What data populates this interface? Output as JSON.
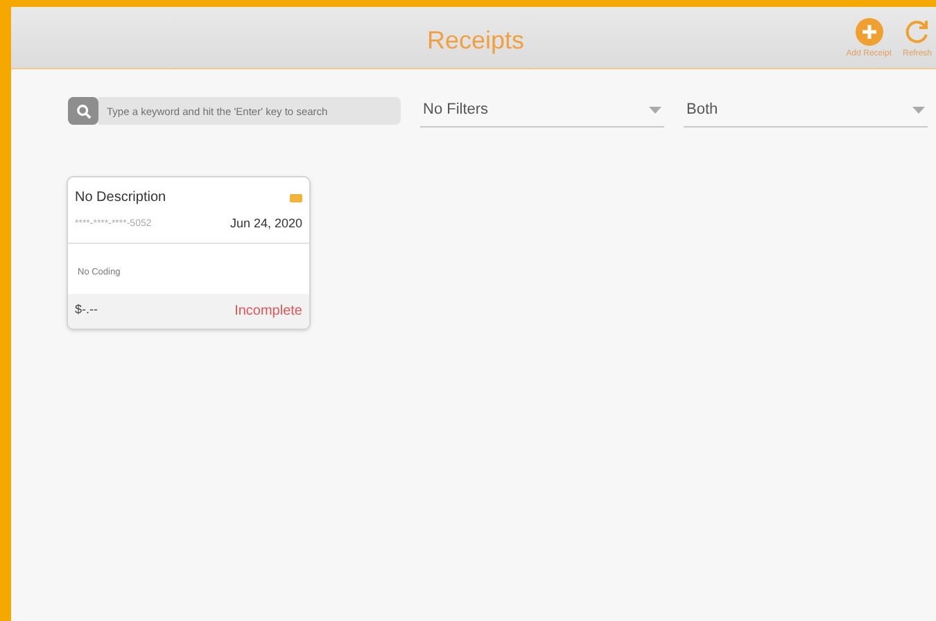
{
  "header": {
    "title": "Receipts",
    "actions": [
      {
        "kind": "add",
        "label": "Add Receipt"
      },
      {
        "kind": "refresh",
        "label": "Refresh"
      }
    ]
  },
  "search": {
    "placeholder": "Type a keyword and hit the 'Enter' key to search"
  },
  "filters": [
    {
      "value": "No Filters"
    },
    {
      "value": "Both"
    }
  ],
  "receipts": [
    {
      "description": "No Description",
      "card": "****-****-****-5052",
      "date": "Jun 24, 2020",
      "coding": "No Coding",
      "amount": "$-.--",
      "status": "Incomplete"
    }
  ]
}
